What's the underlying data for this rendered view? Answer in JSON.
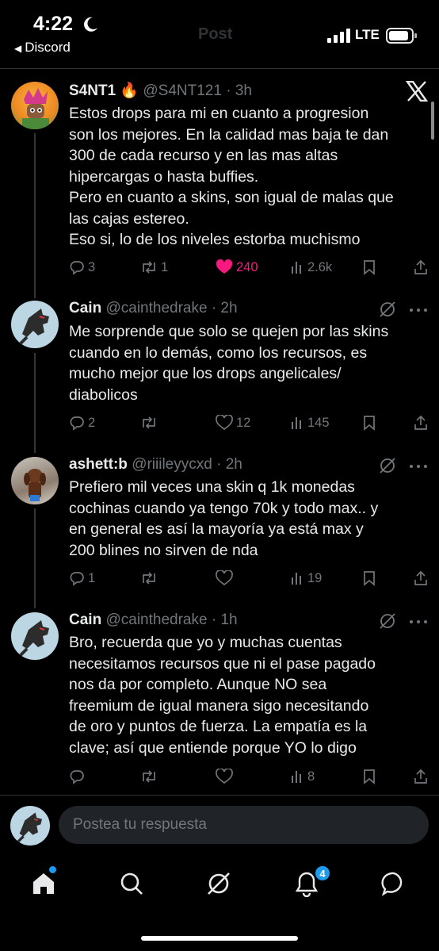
{
  "status_bar": {
    "time": "4:22",
    "back_app": "Discord",
    "network": "LTE",
    "ghost_title": "Post"
  },
  "tweets": [
    {
      "name": "S4NT1",
      "emoji": "🔥",
      "handle": "@S4NT121 · 3h",
      "text": "Estos drops para mi en cuanto a progresion\nson los mejores. En la calidad mas baja te dan\n300 de cada recurso y en las mas altas\nhipercargas o hasta buffies.\nPero en cuanto a skins, son igual de malas que\nlas cajas estereo.\nEso si, lo de los niveles estorba muchismo",
      "replies": "3",
      "reposts": "1",
      "likes": "240",
      "views": "2.6k",
      "liked": true
    },
    {
      "name": "Cain",
      "handle": "@cainthedrake · 2h",
      "text": "Me sorprende que solo se quejen por las skins\ncuando en lo demás, como los recursos, es\nmucho mejor que los drops angelicales/\ndiabolicos",
      "replies": "2",
      "reposts": "",
      "likes": "12",
      "views": "145"
    },
    {
      "name": "ashett:b",
      "handle": "@riiileyycxd · 2h",
      "text": "Prefiero mil veces una skin q 1k monedas\ncochinas cuando ya tengo 70k y todo max.. y\nen general es así la mayoría ya está max y\n200 blines no sirven de nda",
      "replies": "1",
      "reposts": "",
      "likes": "",
      "views": "19"
    },
    {
      "name": "Cain",
      "handle": "@cainthedrake · 1h",
      "text": "Bro, recuerda que yo y muchas cuentas\nnecesitamos recursos que ni el pase pagado\nnos da por completo. Aunque NO sea\nfreemium de igual manera sigo necesitando\nde oro y puntos de fuerza. La empatía es la\nclave; así que entiende porque YO lo digo",
      "replies": "",
      "reposts": "",
      "likes": "",
      "views": "8"
    }
  ],
  "reply": {
    "placeholder": "Postea tu respuesta"
  },
  "tabbar": {
    "notifications_badge": "4"
  },
  "colors": {
    "accent": "#1d9bf0",
    "like": "#f91880",
    "muted": "#71767b"
  }
}
